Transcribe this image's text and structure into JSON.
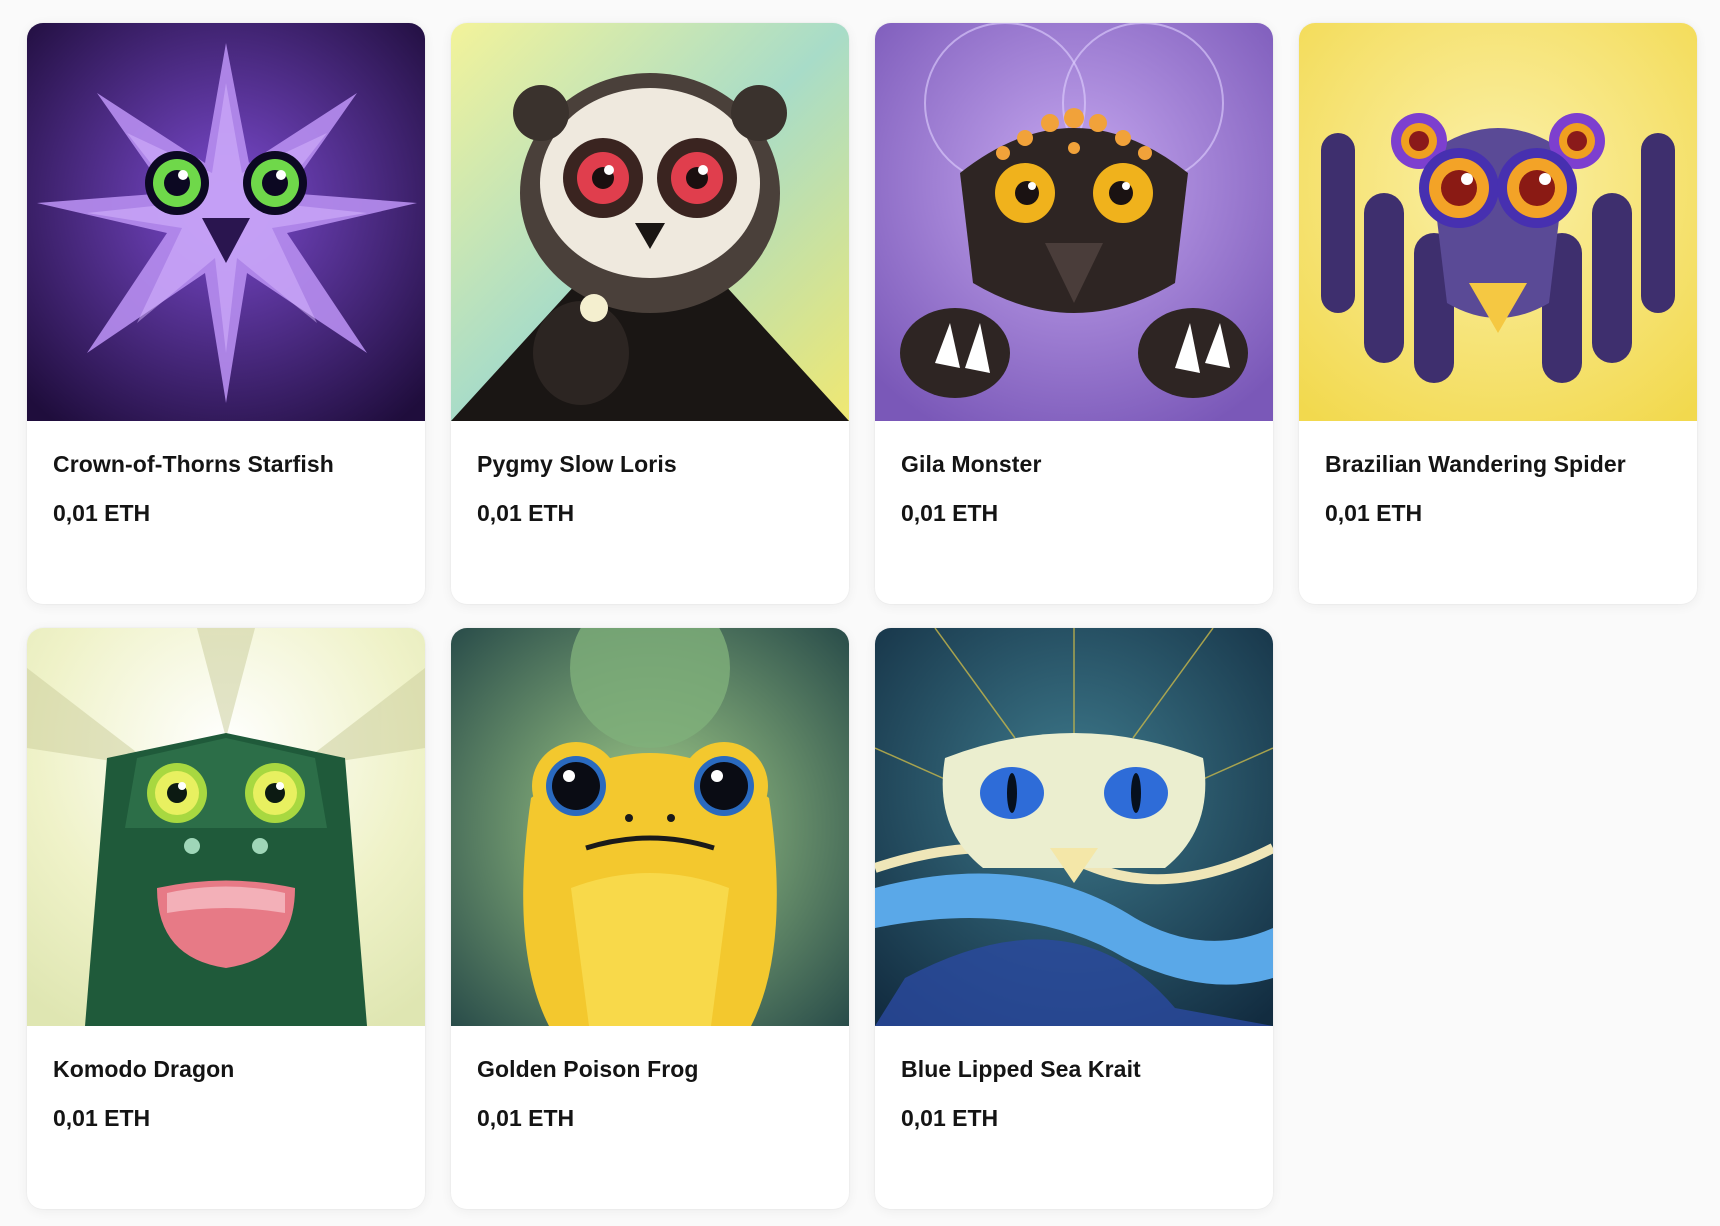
{
  "collection": {
    "items": [
      {
        "title": "Crown-of-Thorns Starfish",
        "price": "0,01 ETH",
        "icon": "starfish-artwork"
      },
      {
        "title": "Pygmy Slow Loris",
        "price": "0,01 ETH",
        "icon": "slow-loris-artwork"
      },
      {
        "title": "Gila Monster",
        "price": "0,01 ETH",
        "icon": "gila-monster-artwork"
      },
      {
        "title": "Brazilian Wandering Spider",
        "price": "0,01 ETH",
        "icon": "spider-artwork"
      },
      {
        "title": "Komodo Dragon",
        "price": "0,01 ETH",
        "icon": "komodo-dragon-artwork"
      },
      {
        "title": "Golden Poison Frog",
        "price": "0,01 ETH",
        "icon": "frog-artwork"
      },
      {
        "title": "Blue Lipped Sea Krait",
        "price": "0,01 ETH",
        "icon": "sea-krait-artwork"
      }
    ]
  },
  "colors": {
    "background": "#fafafa",
    "card": "#ffffff",
    "text": "#141414",
    "starfish": "#3b1a6b",
    "loris": "#e6e37a",
    "gila": "#9a7ad0",
    "spider": "#f3dd64",
    "komodo": "#1f5a3a",
    "frog": "#f2c531",
    "krait": "#1e4a64"
  }
}
